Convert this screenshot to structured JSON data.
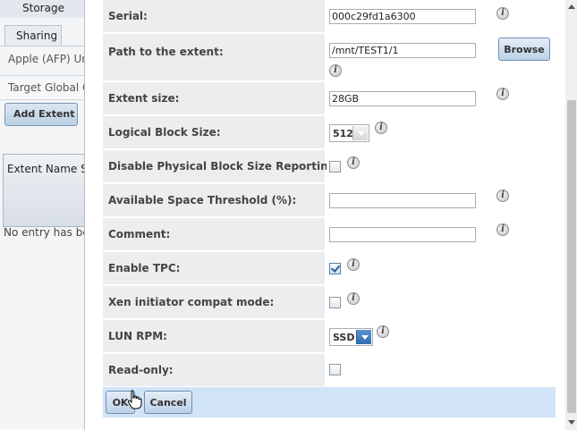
{
  "background": {
    "top_nav": "Storage",
    "tab": "Sharing",
    "subtabs": "Apple (AFP)  Unix",
    "target": "Target Global Configuration",
    "add_button": "Add Extent",
    "grid_header": "Extent Name  Serial",
    "empty_text": "No entry has been found"
  },
  "form": {
    "serial": {
      "label": "Serial:",
      "value": "000c29fd1a6300"
    },
    "path": {
      "label": "Path to the extent:",
      "value": "/mnt/TEST1/1",
      "browse": "Browse"
    },
    "extent_size": {
      "label": "Extent size:",
      "value": "28GB"
    },
    "block_size": {
      "label": "Logical Block Size:",
      "value": "512"
    },
    "disable_pbsr": {
      "label": "Disable Physical Block Size Reporting:",
      "checked": false
    },
    "space_threshold": {
      "label": "Available Space Threshold (%):",
      "value": ""
    },
    "comment": {
      "label": "Comment:",
      "value": ""
    },
    "enable_tpc": {
      "label": "Enable TPC:",
      "checked": true
    },
    "xen_compat": {
      "label": "Xen initiator compat mode:",
      "checked": false
    },
    "lun_rpm": {
      "label": "LUN RPM:",
      "value": "SSD"
    },
    "read_only": {
      "label": "Read-only:",
      "checked": false
    },
    "info_glyph": "i"
  },
  "footer": {
    "ok": "OK",
    "cancel": "Cancel"
  },
  "colors": {
    "label_bg": "#ecedef",
    "footer_bg": "#d1e4f7",
    "select_arrow": "#2f6db3"
  },
  "icons": [
    "info-icon",
    "checkbox",
    "dropdown-arrow-icon",
    "hand-cursor-icon"
  ]
}
